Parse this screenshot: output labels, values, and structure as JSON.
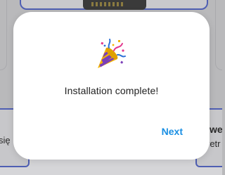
{
  "background": {
    "left_text": "się",
    "right_title": "wer",
    "right_text": "retr"
  },
  "dialog": {
    "icon": "party-popper-icon",
    "message": "Installation complete!",
    "next_label": "Next"
  },
  "colors": {
    "accent": "#1a8fe3",
    "overlay": "#b9b9bb",
    "card_border": "#4f5fb3"
  }
}
